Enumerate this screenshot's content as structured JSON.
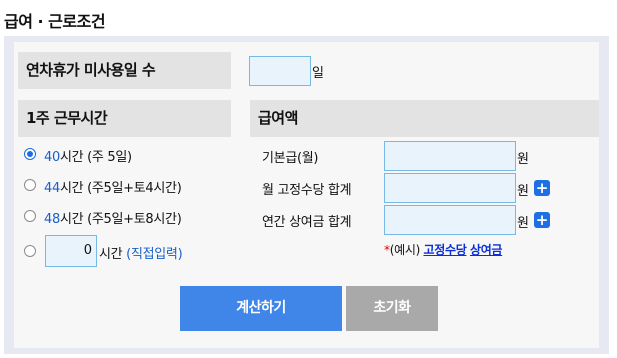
{
  "page": {
    "title": "급여 · 근로조건"
  },
  "annual_leave": {
    "label": "연차휴가 미사용일 수",
    "value": "",
    "unit": "일"
  },
  "work_hours": {
    "header": "1주 근무시간",
    "options": [
      {
        "number": "40",
        "text": "시간 (주 5일)",
        "selected": true
      },
      {
        "number": "44",
        "text": "시간 (주5일+토4시간)",
        "selected": false
      },
      {
        "number": "48",
        "text": "시간 (주5일+토8시간)",
        "selected": false
      }
    ],
    "custom": {
      "value": "0",
      "suffix": "시간",
      "hint": "(직접입력)",
      "selected": false
    }
  },
  "pay": {
    "header": "급여액",
    "rows": [
      {
        "label": "기본급(월)",
        "value": "",
        "unit": "원"
      },
      {
        "label": "월 고정수당 합계",
        "value": "",
        "unit": "원",
        "add_icon": "plus-icon"
      },
      {
        "label": "연간 상여금 합계",
        "value": "",
        "unit": "원",
        "add_icon": "plus-icon"
      }
    ],
    "example": {
      "star": "*",
      "prefix": "(예시)",
      "link1": "고정수당",
      "link2": "상여금"
    }
  },
  "buttons": {
    "calculate": "계산하기",
    "reset": "초기화"
  },
  "colors": {
    "primary": "#3f86e8",
    "secondary": "#a9a9a9",
    "input_bg": "#e8f3fc",
    "input_border": "#77b9e6",
    "accent_blue": "#1a5fc8",
    "link": "#0b2fd6",
    "star": "#e00000"
  }
}
